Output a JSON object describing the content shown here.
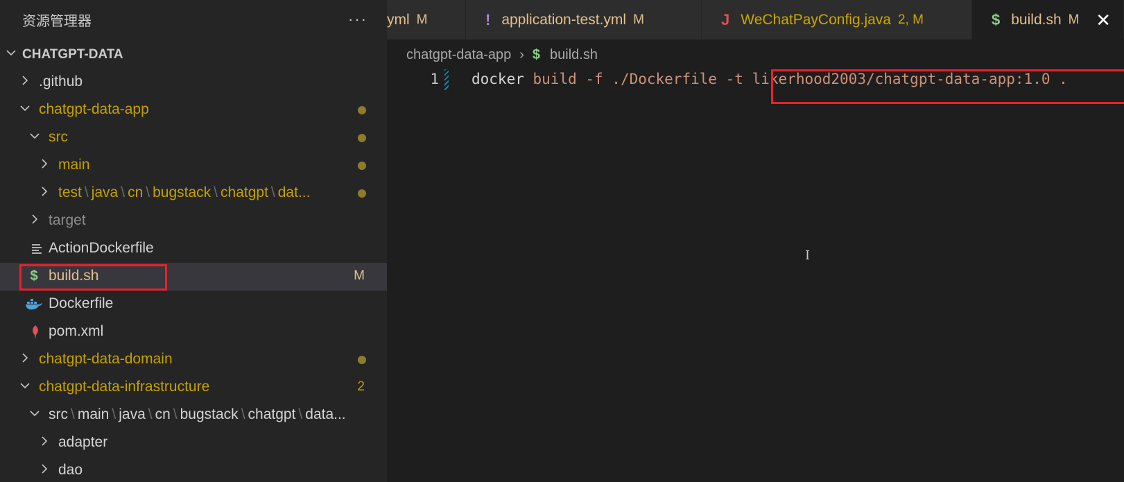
{
  "sidebar": {
    "title": "资源管理器",
    "more": "···",
    "root": "CHATGPT-DATA",
    "items": [
      {
        "label": ".github"
      },
      {
        "label": "chatgpt-data-app"
      },
      {
        "label": "src"
      },
      {
        "label": "main"
      },
      {
        "path": [
          "test",
          "java",
          "cn",
          "bugstack",
          "chatgpt",
          "dat..."
        ]
      },
      {
        "label": "target"
      },
      {
        "label": "ActionDockerfile"
      },
      {
        "label": "build.sh",
        "status": "M"
      },
      {
        "label": "Dockerfile"
      },
      {
        "label": "pom.xml"
      },
      {
        "label": "chatgpt-data-domain"
      },
      {
        "label": "chatgpt-data-infrastructure",
        "status": "2"
      },
      {
        "path": [
          "src",
          "main",
          "java",
          "cn",
          "bugstack",
          "chatgpt",
          "data..."
        ]
      },
      {
        "label": "adapter"
      },
      {
        "label": "dao"
      }
    ]
  },
  "tabs": [
    {
      "label": "yml",
      "status": "M",
      "icon": ""
    },
    {
      "label": "application-test.yml",
      "status": "M",
      "icon": "!"
    },
    {
      "label": "WeChatPayConfig.java",
      "status": "2, M",
      "icon": "J"
    },
    {
      "label": "build.sh",
      "status": "M",
      "icon": "$",
      "close": "✕"
    }
  ],
  "breadcrumb": {
    "folder": "chatgpt-data-app",
    "sep": "›",
    "icon": "$",
    "file": "build.sh"
  },
  "editor": {
    "line_number": "1",
    "code": {
      "cmd": "docker",
      "args1": "build -f ./Dockerfile -t",
      "args2": "likerhood2003/chatgpt-data-app:1.0 ."
    }
  },
  "colors": {
    "modified": "#cca700",
    "highlight": "#e8212b",
    "shell_icon": "#89d185",
    "java_icon": "#e05151",
    "yaml_icon": "#b180d7",
    "docker_icon": "#4da3d8",
    "maven_icon": "#e05151"
  },
  "icons": {
    "shell": "dollar-icon",
    "java": "java-icon",
    "yaml": "exclamation-icon",
    "docker": "docker-whale-icon",
    "maven": "feather-icon",
    "text": "lines-icon"
  }
}
